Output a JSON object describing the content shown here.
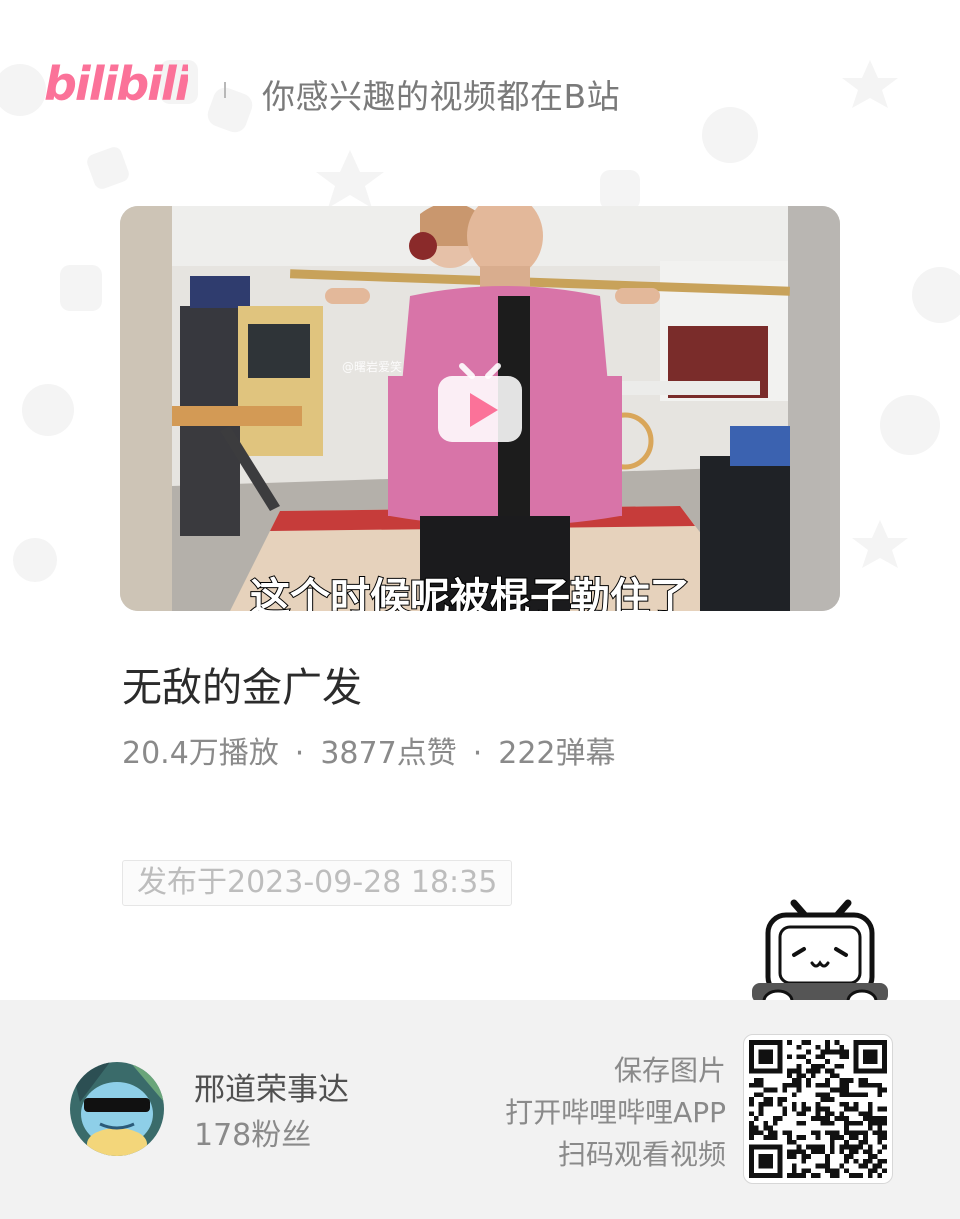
{
  "header": {
    "logo_text": "bilibili",
    "tagline": "你感兴趣的视频都在B站"
  },
  "video": {
    "thumbnail_caption": "这个时候呢被棍子勒住了",
    "watermark": "@曙岩爱笑",
    "title": "无敌的金广发",
    "stats": {
      "plays": "20.4万播放",
      "likes": "3877点赞",
      "danmaku": "222弹幕",
      "separator": "·"
    },
    "published": "发布于2023-09-28 18:35"
  },
  "uploader": {
    "name": "邢道荣事达",
    "followers": "178粉丝"
  },
  "cta": {
    "line1": "保存图片",
    "line2": "打开哔哩哔哩APP",
    "line3": "扫码观看视频"
  },
  "colors": {
    "brand_pink": "#fb7299",
    "text_dark": "#2b2b2b",
    "text_gray": "#8a8a8a",
    "footer_bg": "#f2f2f2"
  },
  "icons": [
    "play-icon",
    "bilibili-tv-mascot-icon",
    "qr-code-icon",
    "avatar-icon"
  ]
}
